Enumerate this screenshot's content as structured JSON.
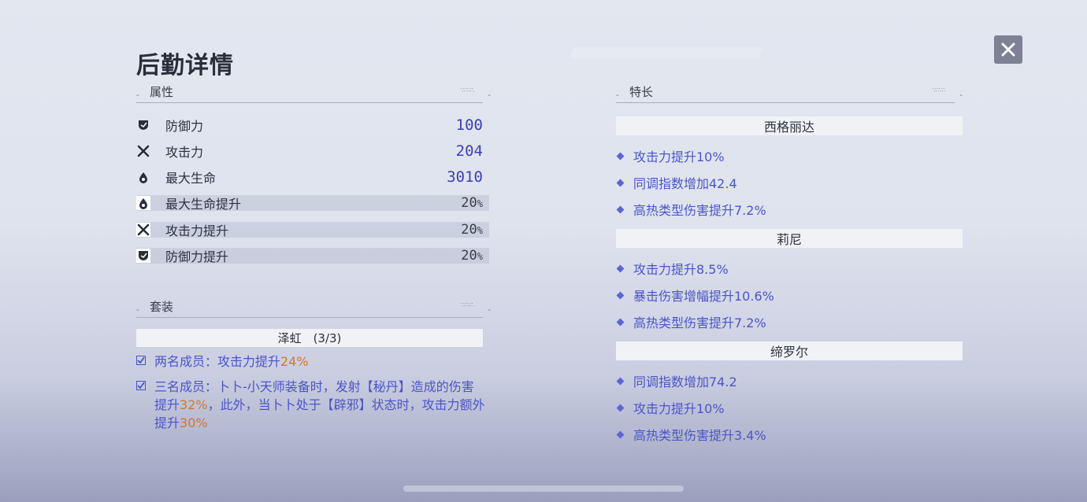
{
  "title": "后勤详情",
  "close_label": "×",
  "attributes": {
    "header": "属性",
    "stats": [
      {
        "icon": "shield-icon",
        "name": "防御力",
        "value": "100",
        "pct": ""
      },
      {
        "icon": "cross-blades-icon",
        "name": "攻击力",
        "value": "204",
        "pct": ""
      },
      {
        "icon": "drop-icon",
        "name": "最大生命",
        "value": "3010",
        "pct": ""
      },
      {
        "icon": "drop-icon",
        "name": "最大生命提升",
        "value": "20",
        "pct": "%"
      },
      {
        "icon": "cross-blades-icon",
        "name": "攻击力提升",
        "value": "20",
        "pct": "%"
      },
      {
        "icon": "shield-icon",
        "name": "防御力提升",
        "value": "20",
        "pct": "%"
      }
    ]
  },
  "set": {
    "header": "套装",
    "name": "泽虹 (3/3)",
    "effects": [
      {
        "a": "两名成员：攻击力提升",
        "b": "24%",
        "c": "",
        "d": "",
        "e": "",
        "f": ""
      },
      {
        "a": "三名成员：卜卜-小天师装备时，发射【秘丹】造成的伤害提升",
        "b": "32%",
        "c": "，此外，当卜卜处于【辟邪】状态时，攻击力额外提升",
        "d": "30%",
        "e": "",
        "f": ""
      }
    ]
  },
  "specialties": {
    "header": "特长",
    "characters": [
      {
        "name": "西格丽达",
        "items": [
          "攻击力提升10%",
          "同调指数增加42.4",
          "高热类型伤害提升7.2%"
        ]
      },
      {
        "name": "莉尼",
        "items": [
          "攻击力提升8.5%",
          "暴击伤害增幅提升10.6%",
          "高热类型伤害提升7.2%"
        ]
      },
      {
        "name": "缔罗尔",
        "items": [
          "同调指数增加74.2",
          "攻击力提升10%",
          "高热类型伤害提升3.4%"
        ]
      }
    ]
  },
  "colors": {
    "accent": "#4a55c8",
    "highlight": "#d4772a",
    "value": "#3b3fb3"
  }
}
